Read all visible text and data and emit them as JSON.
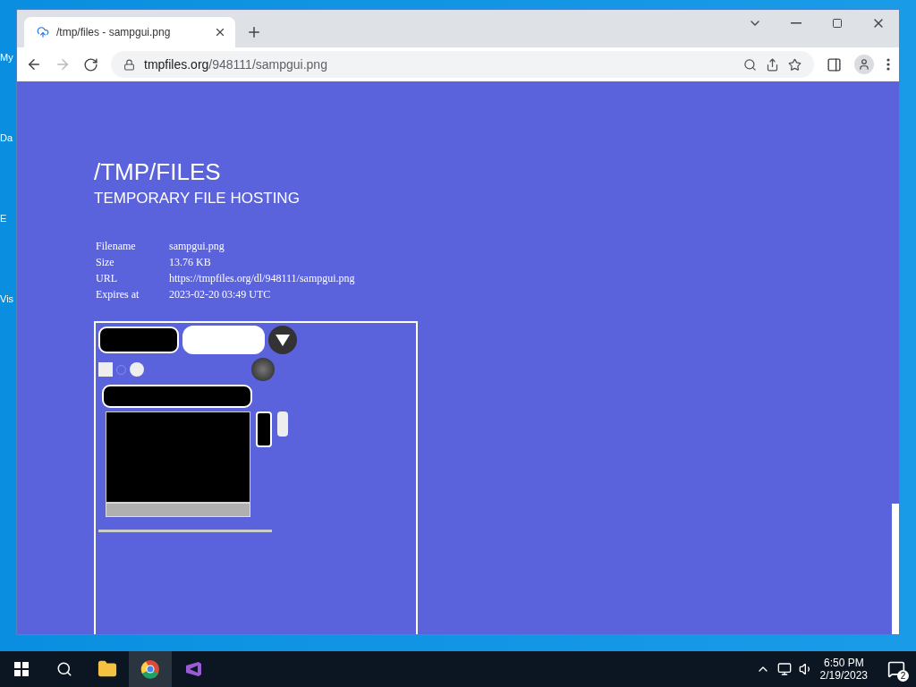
{
  "desktop_icons": [
    {
      "label": "My"
    },
    {
      "label": "Da"
    },
    {
      "label": "E"
    },
    {
      "label": "Vis"
    }
  ],
  "browser": {
    "tab": {
      "title": "/tmp/files - sampgui.png",
      "selected": true
    },
    "url_host": "tmpfiles.org",
    "url_path": "/948111/sampgui.png"
  },
  "page": {
    "title": "/TMP/FILES",
    "subtitle": "TEMPORARY FILE HOSTING",
    "details": [
      {
        "label": "Filename",
        "value": "sampgui.png"
      },
      {
        "label": "Size",
        "value": "13.76 KB"
      },
      {
        "label": "URL",
        "value": "https://tmpfiles.org/dl/948111/sampgui.png"
      },
      {
        "label": "Expires at",
        "value": "2023-02-20 03:49 UTC"
      }
    ]
  },
  "taskbar": {
    "time": "6:50 PM",
    "date": "2/19/2023",
    "notifications": "2"
  }
}
